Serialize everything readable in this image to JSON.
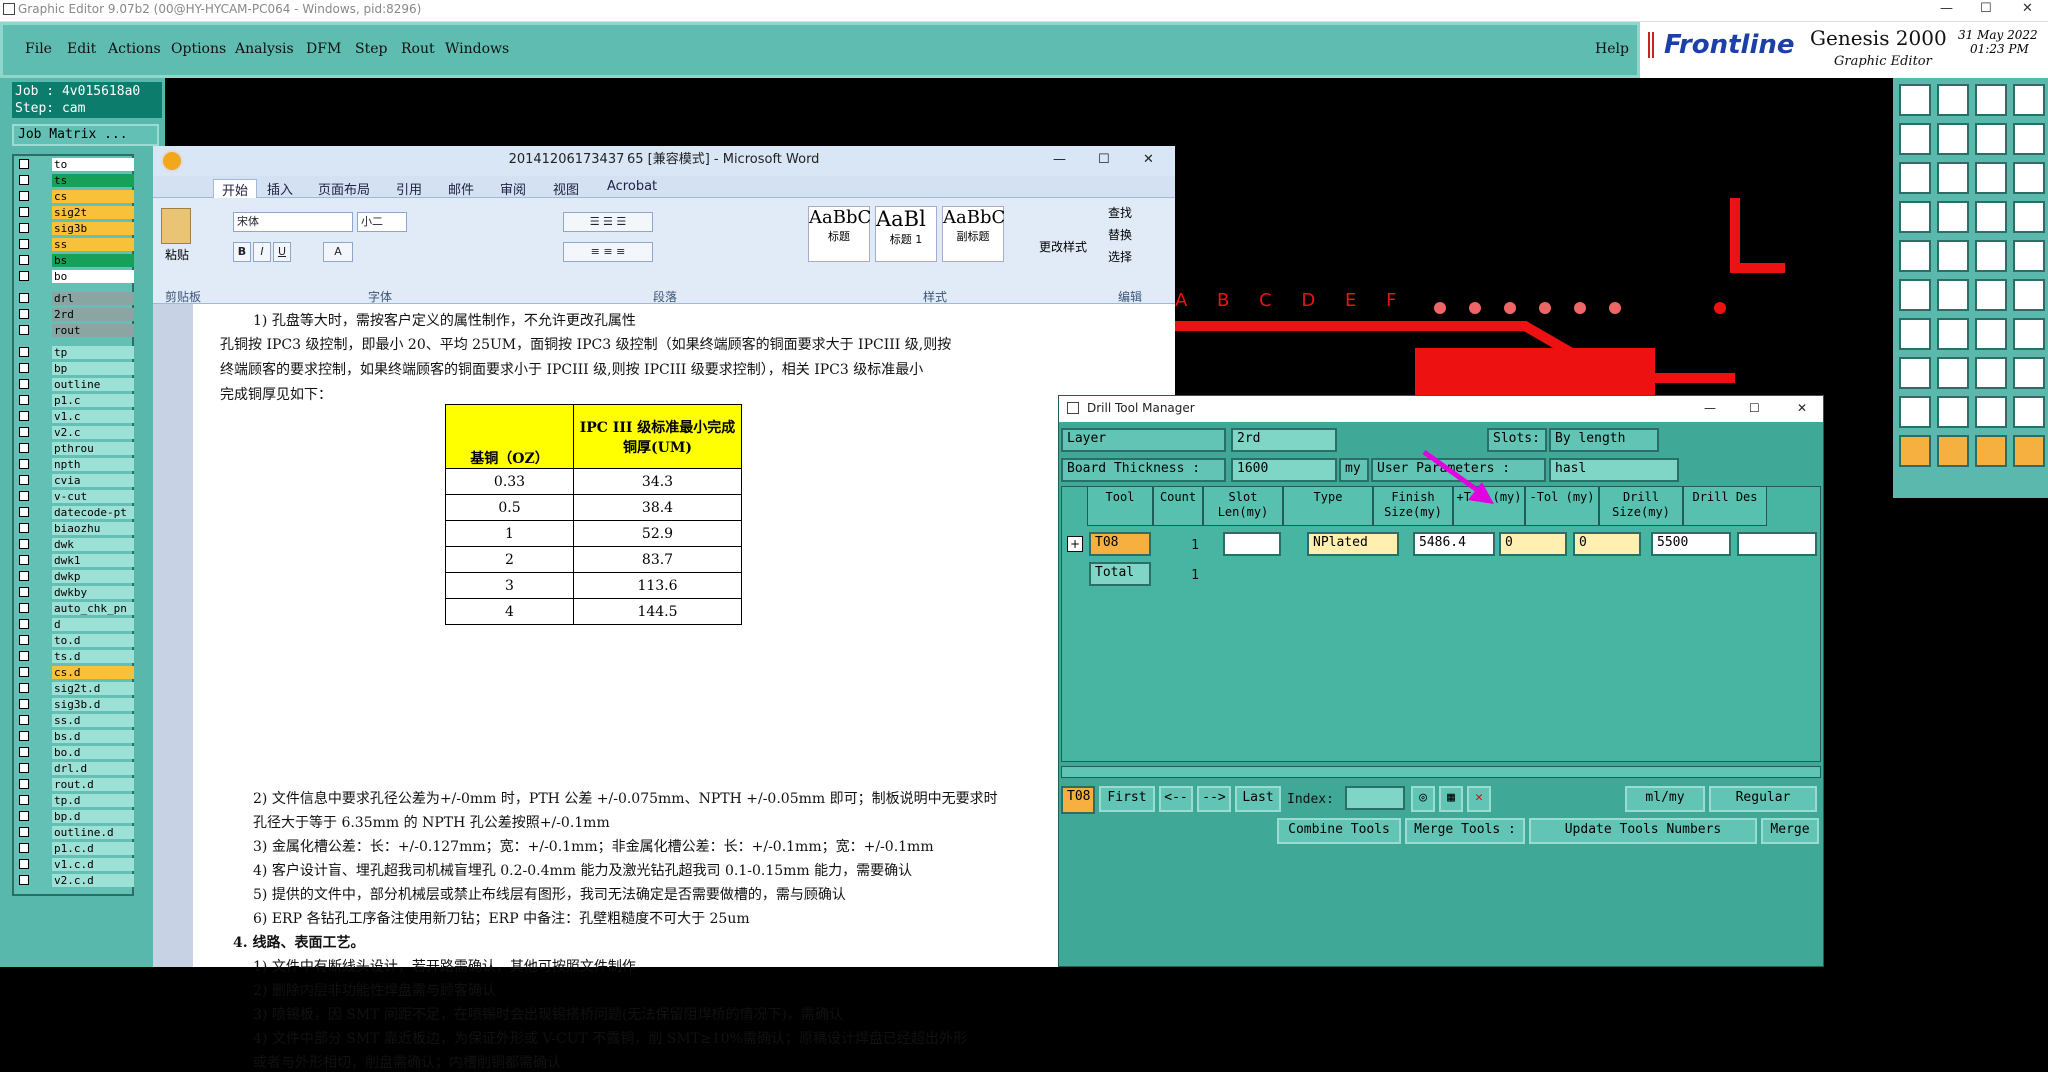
{
  "app": {
    "title": "Graphic Editor 9.07b2 (00@HY-HYCAM-PC064 - Windows, pid:8296)"
  },
  "menu": [
    "File",
    "Edit",
    "Actions",
    "Options",
    "Analysis",
    "DFM",
    "Step",
    "Rout",
    "Windows"
  ],
  "help": "Help",
  "brand": {
    "logo": "Frontline",
    "product": "Genesis 2000",
    "sub": "Graphic Editor",
    "date": "31 May 2022",
    "time": "01:23 PM"
  },
  "job": {
    "job": "Job : 4v015618a0",
    "step": "Step: cam",
    "matrix_btn": "Job Matrix ..."
  },
  "layers": [
    {
      "n": "to",
      "c": "white"
    },
    {
      "n": "ts",
      "c": "sel"
    },
    {
      "n": "cs",
      "c": "yel"
    },
    {
      "n": "sig2t",
      "c": "yel"
    },
    {
      "n": "sig3b",
      "c": "yel"
    },
    {
      "n": "ss",
      "c": "yel"
    },
    {
      "n": "bs",
      "c": "sel"
    },
    {
      "n": "bo",
      "c": "white"
    },
    {
      "n": "drl",
      "c": "gray"
    },
    {
      "n": "2rd",
      "c": "gray"
    },
    {
      "n": "rout",
      "c": "gray"
    },
    {
      "n": "tp",
      "c": ""
    },
    {
      "n": "bp",
      "c": ""
    },
    {
      "n": "outline",
      "c": ""
    },
    {
      "n": "p1.c",
      "c": ""
    },
    {
      "n": "v1.c",
      "c": ""
    },
    {
      "n": "v2.c",
      "c": ""
    },
    {
      "n": "pthrou",
      "c": ""
    },
    {
      "n": "npth",
      "c": ""
    },
    {
      "n": "cvia",
      "c": ""
    },
    {
      "n": "v-cut",
      "c": ""
    },
    {
      "n": "datecode-pt",
      "c": ""
    },
    {
      "n": "biaozhu",
      "c": ""
    },
    {
      "n": "dwk",
      "c": ""
    },
    {
      "n": "dwk1",
      "c": ""
    },
    {
      "n": "dwkp",
      "c": ""
    },
    {
      "n": "dwkby",
      "c": ""
    },
    {
      "n": "auto_chk_pn",
      "c": ""
    },
    {
      "n": "d",
      "c": ""
    },
    {
      "n": "to.d",
      "c": ""
    },
    {
      "n": "ts.d",
      "c": ""
    },
    {
      "n": "cs.d",
      "c": "yel"
    },
    {
      "n": "sig2t.d",
      "c": ""
    },
    {
      "n": "sig3b.d",
      "c": ""
    },
    {
      "n": "ss.d",
      "c": ""
    },
    {
      "n": "bs.d",
      "c": ""
    },
    {
      "n": "bo.d",
      "c": ""
    },
    {
      "n": "drl.d",
      "c": ""
    },
    {
      "n": "rout.d",
      "c": ""
    },
    {
      "n": "tp.d",
      "c": ""
    },
    {
      "n": "bp.d",
      "c": ""
    },
    {
      "n": "outline.d",
      "c": ""
    },
    {
      "n": "p1.c.d",
      "c": ""
    },
    {
      "n": "v1.c.d",
      "c": ""
    },
    {
      "n": "v2.c.d",
      "c": ""
    }
  ],
  "word": {
    "title": "20141206173437 65 [兼容模式] - Microsoft Word",
    "tabs": [
      "开始",
      "插入",
      "页面布局",
      "引用",
      "邮件",
      "审阅",
      "视图",
      "Acrobat"
    ],
    "groups": [
      "剪贴板",
      "字体",
      "段落",
      "样式",
      "编辑"
    ],
    "font": "宋体",
    "size": "小二",
    "paste": "粘贴",
    "styles": [
      "AaBbC",
      "AaBl",
      "AaBbC"
    ],
    "style_names": [
      "标题",
      "标题 1",
      "副标题"
    ],
    "change_style": "更改样式",
    "edit": [
      "查找",
      "替换",
      "选择"
    ],
    "lines": [
      "1)  孔盘等大时，需按客户定义的属性制作，不允许更改孔属性",
      "孔铜按 IPC3 级控制，即最小 20、平均 25UM，面铜按 IPC3 级控制（如果终端顾客的铜面要求大于 IPCIII 级,则按",
      "终端顾客的要求控制，如果终端顾客的铜面要求小于 IPCIII 级,则按 IPCIII 级要求控制），相关 IPC3 级标准最小",
      "完成铜厚见如下：",
      "2)  文件信息中要求孔径公差为+/-0mm 时，PTH 公差 +/-0.075mm、NPTH +/-0.05mm 即可；制板说明中无要求时",
      "    孔径大于等于 6.35mm 的 NPTH 孔公差按照+/-0.1mm",
      "3)  金属化槽公差：长：+/-0.127mm；宽：+/-0.1mm；非金属化槽公差：长：+/-0.1mm；宽：+/-0.1mm",
      "4)  客户设计盲、埋孔超我司机械盲埋孔 0.2-0.4mm 能力及激光钻孔超我司 0.1-0.15mm 能力，需要确认",
      "5)  提供的文件中，部分机械层或禁止布线层有图形，我司无法确定是否需要做槽的，需与顾确认",
      "6)  ERP 各钻孔工序备注使用新刀钻；ERP 中备注：孔壁粗糙度不可大于 25um",
      "4.   线路、表面工艺。",
      "1)  文件中有断线头设计，若开路需确认，其他可按照文件制作",
      "2)  删除内层非功能性焊盘需与顾客确认",
      "3)  喷锡板，因 SMT 间距不足，在喷锡时会出现锡搭桥问题(无法保留阻焊桥的情况下)，需确认",
      "4)  文件中部分 SMT 靠近板边，为保证外形或 V-CUT 不露铜，削 SMT≥10%需确认；原稿设计焊盘已经超出外形",
      "    或者与外形相切，削盘需确认；内槽削铜都需确认"
    ],
    "table": {
      "h1": "基铜（OZ）",
      "h2": "IPC III 级标准最小完成铜厚(UM)",
      "rows": [
        [
          "0.33",
          "34.3"
        ],
        [
          "0.5",
          "38.4"
        ],
        [
          "1",
          "52.9"
        ],
        [
          "2",
          "83.7"
        ],
        [
          "3",
          "113.6"
        ],
        [
          "4",
          "144.5"
        ]
      ]
    }
  },
  "canvas_letters": "A B C D E F",
  "drill": {
    "title": "Drill Tool Manager",
    "layer_label": "Layer",
    "layer": "2rd",
    "slots_label": "Slots:",
    "slots": "By length",
    "thick_label": "Board Thickness :",
    "thick": "1600",
    "thick_unit": "my",
    "user_label": "User Parameters :",
    "user": "hasl",
    "headers": [
      "Tool",
      "Count",
      "Slot Len(my)",
      "Type",
      "Finish Size(my)",
      "+Tol (my)",
      "-Tol (my)",
      "Drill Size(my)",
      "Drill Des"
    ],
    "row": {
      "tool": "T08",
      "count": "1",
      "slot": "",
      "type": "NPlated",
      "finish": "5486.4",
      "ptol": "0",
      "ntol": "0",
      "drill": "5500",
      "des": ""
    },
    "total": {
      "label": "Total",
      "count": "1"
    },
    "nav": {
      "cur": "T08",
      "first": "First",
      "prev": "<--",
      "next": "-->",
      "last": "Last",
      "index": "Index:",
      "units": "ml/my",
      "mode": "Regular"
    },
    "bottom": [
      "Combine Tools",
      "Merge Tools :",
      "Update Tools Numbers",
      "Merge"
    ]
  },
  "colors": {
    "teal": "#58b8ac",
    "red": "#e11",
    "magenta": "#e000e0"
  }
}
